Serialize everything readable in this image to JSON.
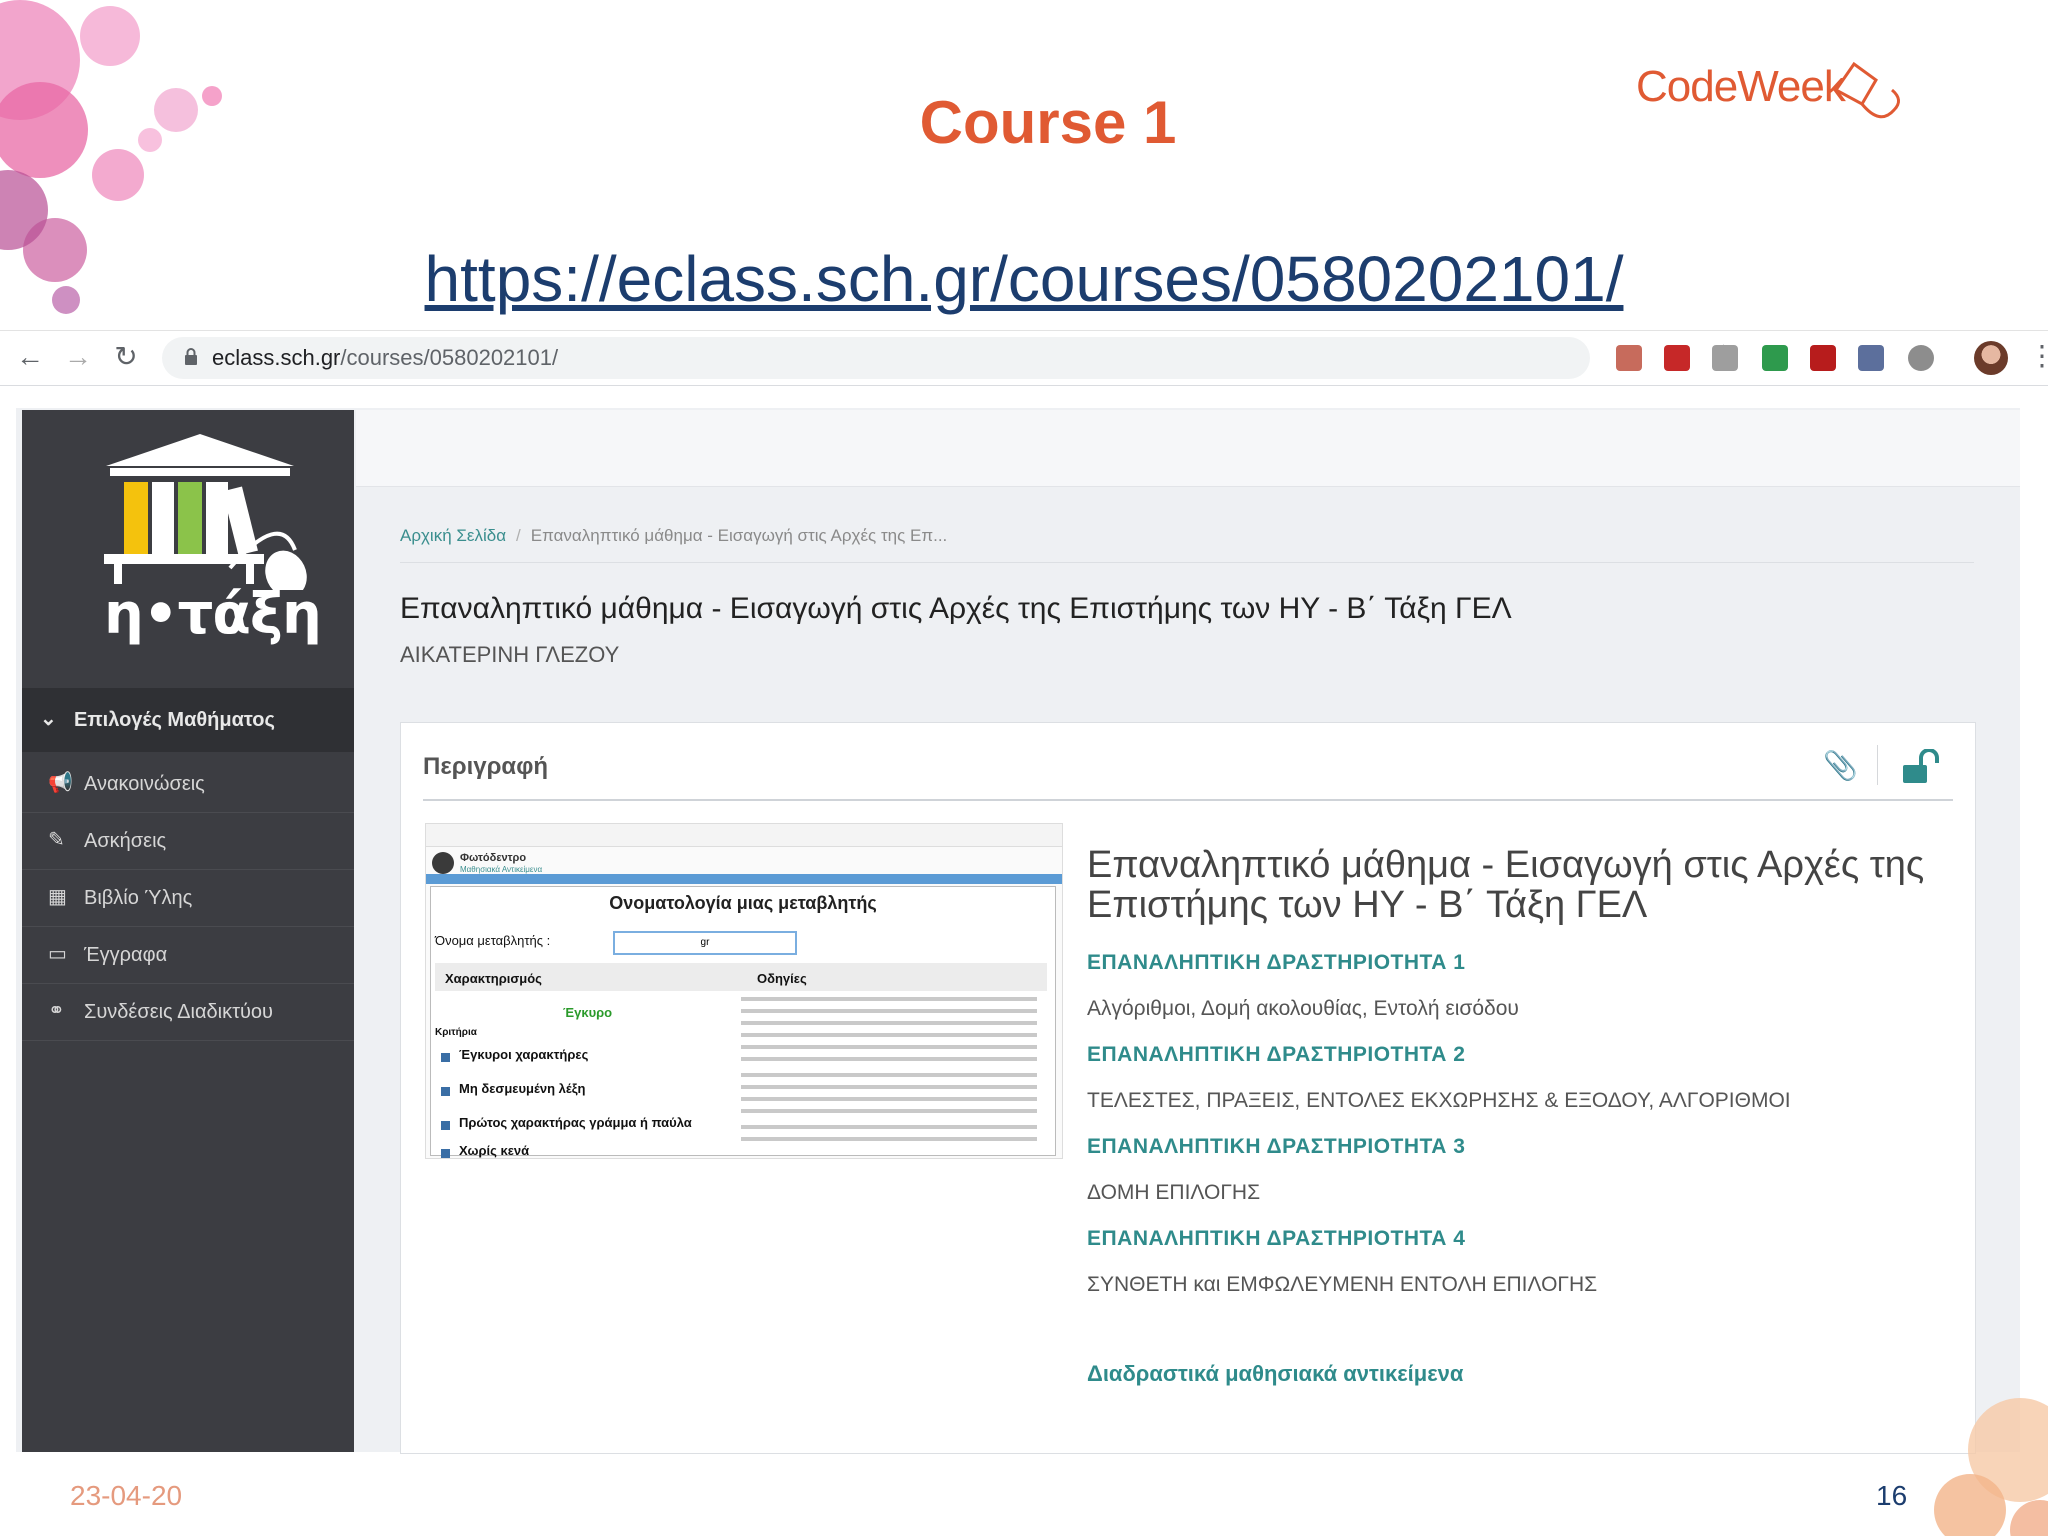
{
  "slide": {
    "title": "Course 1",
    "link": "https://eclass.sch.gr/courses/0580202101/",
    "brand": "CodeWeek",
    "date": "23-04-20",
    "page_number": "16"
  },
  "browser": {
    "url_host": "eclass.sch.gr",
    "url_path": "/courses/0580202101/"
  },
  "sidebar": {
    "logo_text": "η•τάξη",
    "section_label": "Επιλογές Μαθήματος",
    "items": [
      {
        "label": "Ανακοινώσεις",
        "icon": "megaphone-icon"
      },
      {
        "label": "Ασκήσεις",
        "icon": "edit-icon"
      },
      {
        "label": "Βιβλίο Ύλης",
        "icon": "calendar-icon"
      },
      {
        "label": "Έγγραφα",
        "icon": "folder-icon"
      },
      {
        "label": "Συνδέσεις Διαδικτύου",
        "icon": "link-icon"
      }
    ]
  },
  "main": {
    "breadcrumb": {
      "home": "Αρχική Σελίδα",
      "separator": "/",
      "current": "Επαναληπτικό μάθημα - Εισαγωγή στις Αρχές της Επ..."
    },
    "course_title": "Επαναληπτικό μάθημα - Εισαγωγή στις Αρχές της Επιστήμης των ΗΥ - Β΄ Τάξη ΓΕΛ",
    "teacher": "ΑΙΚΑΤΕΡΙΝΗ ΓΛΕΖΟΥ",
    "description": {
      "title": "Περιγραφή",
      "heading": "Επαναληπτικό μάθημα - Εισαγωγή στις Αρχές της Επιστήμης των ΗΥ - Β΄ Τάξη ΓΕΛ",
      "activities": [
        {
          "title": "ΕΠΑΝΑΛΗΠΤΙΚΗ ΔΡΑΣΤΗΡΙΟΤΗΤΑ 1",
          "desc": "Αλγόριθμοι, Δομή ακολουθίας, Εντολή εισόδου"
        },
        {
          "title": "ΕΠΑΝΑΛΗΠΤΙΚΗ ΔΡΑΣΤΗΡΙΟΤΗΤΑ 2",
          "desc": "ΤΕΛΕΣΤΕΣ, ΠΡΑΞΕΙΣ, ΕΝΤΟΛΕΣ ΕΚΧΩΡΗΣΗΣ & ΕΞΟΔΟΥ, ΑΛΓΟΡΙΘΜΟΙ"
        },
        {
          "title": "ΕΠΑΝΑΛΗΠΤΙΚΗ ΔΡΑΣΤΗΡΙΟΤΗΤΑ 3",
          "desc": "ΔΟΜΗ ΕΠΙΛΟΓΗΣ"
        },
        {
          "title": "ΕΠΑΝΑΛΗΠΤΙΚΗ ΔΡΑΣΤΗΡΙΟΤΗΤΑ 4",
          "desc": "ΣΥΝΘΕΤΗ και ΕΜΦΩΛΕΥΜΕΝΗ ΕΝΤΟΛΗ ΕΠΙΛΟΓΗΣ"
        }
      ],
      "interactive_link": "Διαδραστικά μαθησιακά αντικείμενα"
    },
    "thumbnail": {
      "brand": "Φωτόδεντρο",
      "brand_sub": "Μαθησιακά Αντικείμενα",
      "heading": "Ονοματολογία μιας μεταβλητής",
      "var_label": "Όνομα μεταβλητής :",
      "var_value": "gr",
      "col_char": "Χαρακτηρισμός",
      "col_guide": "Οδηγίες",
      "status": "Έγκυρο",
      "criteria": "Κριτήρια",
      "checks": [
        "Έγκυροι χαρακτήρες",
        "Μη δεσμευμένη λέξη",
        "Πρώτος χαρακτήρας γράμμα ή παύλα",
        "Χωρίς κενά"
      ]
    }
  },
  "colors": {
    "accent_orange": "#e05a33",
    "link_blue": "#1c3d6e",
    "teal": "#2f8b8b",
    "sidebar_bg": "#3c3d42"
  }
}
